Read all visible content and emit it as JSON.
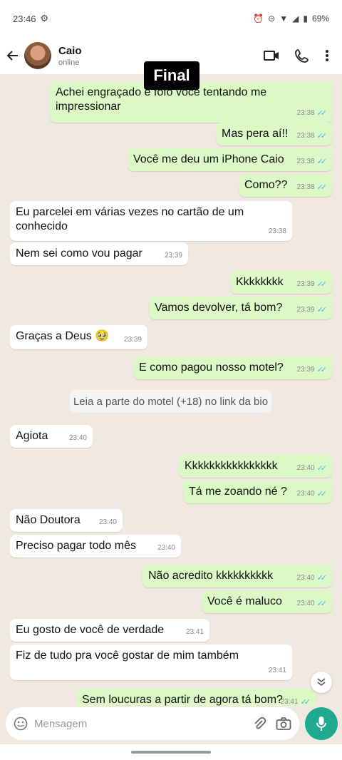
{
  "status_bar": {
    "time": "23:46",
    "battery": "69%"
  },
  "header": {
    "name": "Caio",
    "status": "online"
  },
  "overlay": {
    "label": "Final"
  },
  "messages": [
    {
      "text": "Achei engraçado e fofo você tentando me impressionar",
      "time": "23:38"
    },
    {
      "text": "Mas pera aí!!",
      "time": "23:38"
    },
    {
      "text": "Você me deu um iPhone Caio",
      "time": "23:38"
    },
    {
      "text": "Como??",
      "time": "23:38"
    },
    {
      "text": "Eu parcelei em várias vezes no cartão de um conhecido",
      "time": "23:38"
    },
    {
      "text": "Nem sei como vou pagar",
      "time": "23:39"
    },
    {
      "text": "Kkkkkkkk",
      "time": "23:39"
    },
    {
      "text": "Vamos devolver, tá bom?",
      "time": "23:39"
    },
    {
      "text": "Graças a Deus 🥹",
      "time": "23:39"
    },
    {
      "text": "E como pagou nosso motel?",
      "time": "23:39"
    },
    {
      "text": "Agiota",
      "time": "23:40"
    },
    {
      "text": "Kkkkkkkkkkkkkkkk",
      "time": "23:40"
    },
    {
      "text": "Tá me zoando né ?",
      "time": "23:40"
    },
    {
      "text": "Não Doutora",
      "time": "23:40"
    },
    {
      "text": "Preciso pagar todo mês",
      "time": "23:40"
    },
    {
      "text": "Não acredito kkkkkkkkkk",
      "time": "23:40"
    },
    {
      "text": "Você é maluco",
      "time": "23:40"
    },
    {
      "text": "Eu gosto de você de verdade",
      "time": "23:41"
    },
    {
      "text": "Fiz de tudo pra você gostar de mim também",
      "time": "23:41"
    },
    {
      "text": "Sem loucuras a partir de agora tá bom?",
      "time": "23:41"
    }
  ],
  "system_notice": "Leia a parte do motel (+18) no link da bio",
  "composer": {
    "placeholder": "Mensagem"
  }
}
